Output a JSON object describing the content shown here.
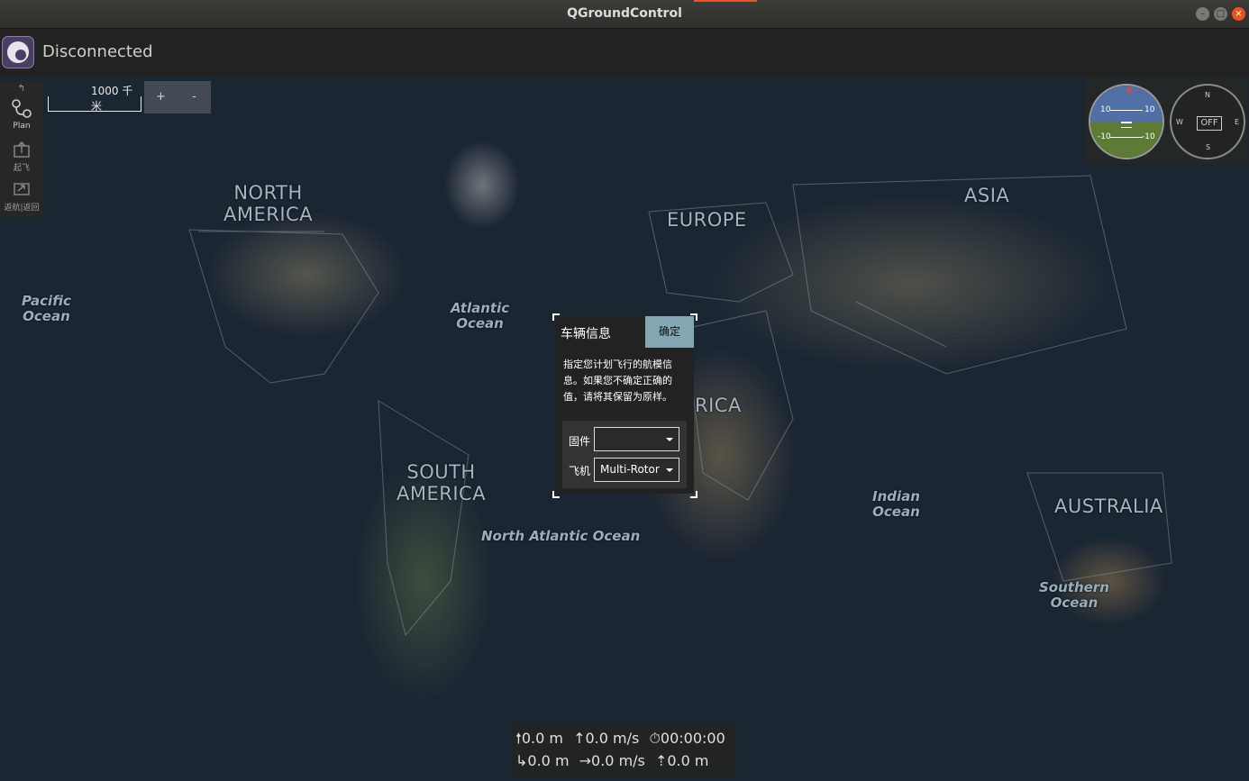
{
  "window": {
    "title": "QGroundControl",
    "buttons": {
      "minimize": "–",
      "maximize": "□",
      "close": "×"
    }
  },
  "toolbar": {
    "status": "Disconnected",
    "logo": "qgc-logo-icon"
  },
  "left_toolbar": {
    "items": [
      {
        "label": "",
        "icon": "drag-handle-icon"
      },
      {
        "label": "Plan",
        "icon": "plan-route-icon"
      },
      {
        "label": "起飞",
        "icon": "takeoff-icon"
      },
      {
        "label": "返航|返回",
        "icon": "return-icon"
      }
    ]
  },
  "map_scale": {
    "label": "1000 千米"
  },
  "zoom": {
    "in": "+",
    "out": "-"
  },
  "map_labels": {
    "north_america": "NORTH\nAMERICA",
    "europe": "EUROPE",
    "asia": "ASIA",
    "africa": "RICA",
    "south_america": "SOUTH\nAMERICA",
    "australia": "AUSTRALIA",
    "pacific": "Pacific\nOcean",
    "atlantic": "Atlantic\nOcean",
    "indian": "Indian\nOcean",
    "north_atlantic": "North Atlantic Ocean",
    "southern": "Southern\nOcean"
  },
  "instruments": {
    "attitude": {
      "pitch_up_left": "10",
      "pitch_up_right": "10",
      "pitch_down_left": "-10",
      "pitch_down_right": "-10"
    },
    "compass": {
      "north": "N",
      "south": "S",
      "east": "E",
      "west": "W",
      "status": "OFF"
    }
  },
  "dialog": {
    "title": "车辆信息",
    "ok_button": "确定",
    "message": "指定您计划飞行的航模信息。如果您不确定正确的值，请将其保留为原样。",
    "firmware_label": "固件",
    "firmware_value": "",
    "vehicle_label": "飞机",
    "vehicle_value": "Multi-Rotor"
  },
  "telemetry": {
    "altitude": "0.0 m",
    "vertical_speed": "0.0 m/s",
    "flight_time": "00:00:00",
    "distance_home": "0.0 m",
    "ground_speed": "0.0 m/s",
    "distance_gcs": "0.0 m"
  },
  "colors": {
    "dialog_button": "#84a7b4",
    "close_button": "#e9531f",
    "logo_bg": "#4a3f63"
  }
}
